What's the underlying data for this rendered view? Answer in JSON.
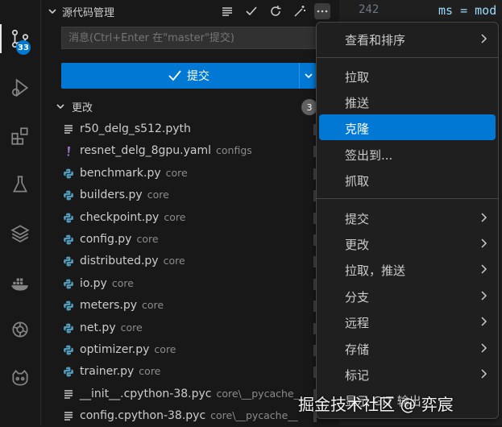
{
  "activity_bar": {
    "scm_badge": "33",
    "items": [
      "source-control-icon",
      "run-debug-icon",
      "extensions-icon",
      "testing-icon",
      "layers-icon",
      "docker-icon",
      "openai-icon",
      "copilot-icon"
    ]
  },
  "scm": {
    "title": "源代码管理",
    "message_placeholder": "消息(Ctrl+Enter 在\"master\"提交)",
    "commit_label": "提交",
    "changes_label": "更改",
    "changes_count": "3",
    "files": [
      {
        "name": "r50_delg_s512.pyth",
        "dir": "",
        "icon": "file-lines-icon"
      },
      {
        "name": "resnet_delg_8gpu.yaml",
        "dir": "configs",
        "icon": "yaml-icon"
      },
      {
        "name": "benchmark.py",
        "dir": "core",
        "icon": "python-icon"
      },
      {
        "name": "builders.py",
        "dir": "core",
        "icon": "python-icon"
      },
      {
        "name": "checkpoint.py",
        "dir": "core",
        "icon": "python-icon"
      },
      {
        "name": "config.py",
        "dir": "core",
        "icon": "python-icon"
      },
      {
        "name": "distributed.py",
        "dir": "core",
        "icon": "python-icon"
      },
      {
        "name": "io.py",
        "dir": "core",
        "icon": "python-icon"
      },
      {
        "name": "meters.py",
        "dir": "core",
        "icon": "python-icon"
      },
      {
        "name": "net.py",
        "dir": "core",
        "icon": "python-icon"
      },
      {
        "name": "optimizer.py",
        "dir": "core",
        "icon": "python-icon"
      },
      {
        "name": "trainer.py",
        "dir": "core",
        "icon": "python-icon"
      },
      {
        "name": "__init__.cpython-38.pyc",
        "dir": "core\\__pycache__",
        "icon": "file-lines-icon"
      },
      {
        "name": "config.cpython-38.pyc",
        "dir": "core\\__pycache__",
        "icon": "file-lines-icon"
      }
    ]
  },
  "editor": {
    "line_number": "242",
    "code": "ms = mod"
  },
  "menu": {
    "items": [
      {
        "label": "查看和排序",
        "submenu": true,
        "selected": false
      },
      {
        "label": "拉取",
        "submenu": false,
        "selected": false
      },
      {
        "label": "推送",
        "submenu": false,
        "selected": false
      },
      {
        "label": "克隆",
        "submenu": false,
        "selected": true
      },
      {
        "label": "签出到...",
        "submenu": false,
        "selected": false
      },
      {
        "label": "抓取",
        "submenu": false,
        "selected": false
      },
      {
        "label": "提交",
        "submenu": true,
        "selected": false
      },
      {
        "label": "更改",
        "submenu": true,
        "selected": false
      },
      {
        "label": "拉取，推送",
        "submenu": true,
        "selected": false
      },
      {
        "label": "分支",
        "submenu": true,
        "selected": false
      },
      {
        "label": "远程",
        "submenu": true,
        "selected": false
      },
      {
        "label": "存储",
        "submenu": true,
        "selected": false
      },
      {
        "label": "标记",
        "submenu": true,
        "selected": false
      },
      {
        "label": "显示 GIT 输出",
        "submenu": false,
        "selected": false
      }
    ]
  },
  "watermark": "掘金技术社区 @ 弈宸",
  "colors": {
    "accent": "#0078d4",
    "background": "#181818",
    "menu_bg": "#1f1f1f",
    "python_icon": "#519aba",
    "yaml_icon": "#a074c4"
  }
}
